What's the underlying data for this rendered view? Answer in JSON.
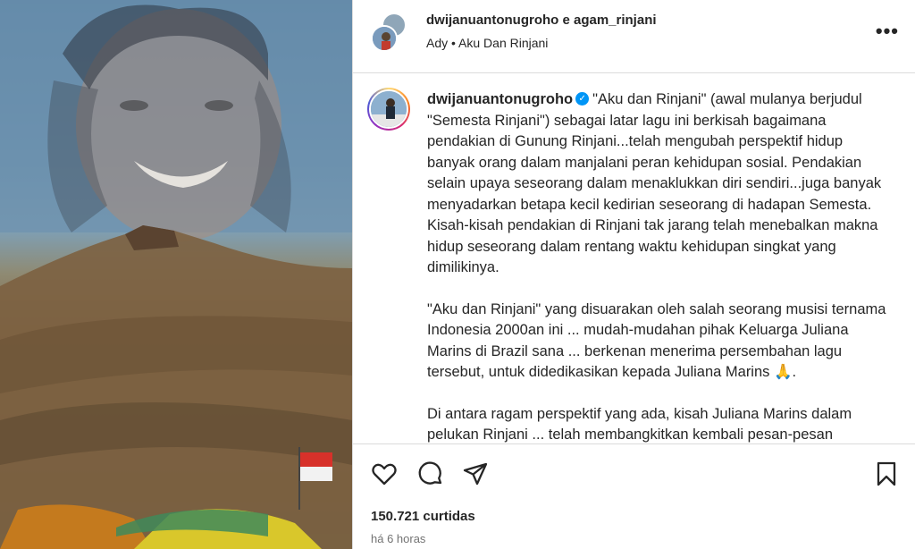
{
  "header": {
    "usernames": "dwijanuantonugroho e agam_rinjani",
    "subtitle": "Ady • Aku Dan Rinjani",
    "more_label": "•••"
  },
  "caption": {
    "username": "dwijanuantonugroho",
    "verified_icon": "verified-badge-icon",
    "paragraph1": "\"Aku dan Rinjani\" (awal mulanya berjudul \"Semesta Rinjani\") sebagai latar lagu ini berkisah bagaimana pendakian di Gunung Rinjani...telah mengubah perspektif hidup banyak orang dalam manjalani peran kehidupan sosial. Pendakian selain upaya seseorang dalam menaklukkan diri sendiri...juga banyak menyadarkan betapa kecil kedirian seseorang di hadapan Semesta. Kisah-kisah pendakian di Rinjani tak jarang telah menebalkan makna hidup seseorang dalam rentang waktu kehidupan singkat yang dimilikinya.",
    "paragraph2": "\"Aku dan Rinjani\"  yang disuarakan oleh salah seorang musisi ternama Indonesia 2000an ini ... mudah-mudahan pihak Keluarga Juliana Marins di Brazil sana ... berkenan menerima persembahan lagu tersebut, untuk didedikasikan kepada Juliana Marins 🙏.",
    "paragraph3": "Di antara ragam perspektif yang ada, kisah Juliana Marins dalam pelukan Rinjani ... telah membangkitkan kembali pesan-pesan"
  },
  "actions": {
    "icons": [
      "heart-icon",
      "comment-icon",
      "share-icon",
      "bookmark-icon"
    ]
  },
  "footer": {
    "likes": "150.721 curtidas",
    "time": "há 6 horas"
  },
  "colors": {
    "accent": "#0095f6",
    "text": "#262626",
    "muted": "#737373",
    "border": "#dbdbdb"
  }
}
